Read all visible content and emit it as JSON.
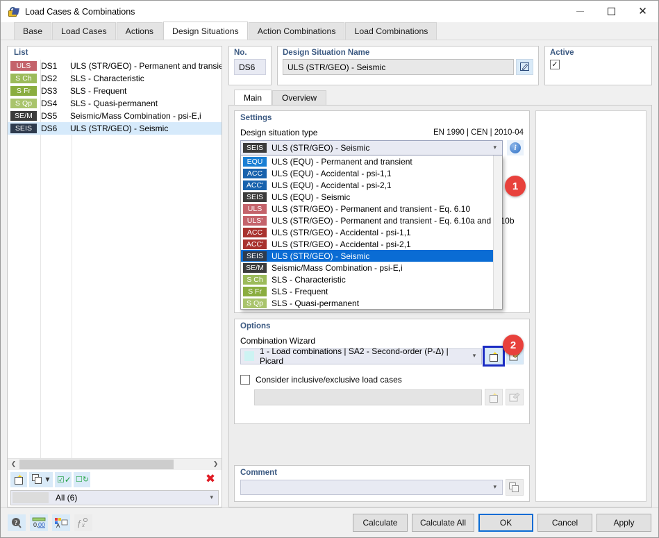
{
  "window": {
    "title": "Load Cases & Combinations",
    "icon": "padlock-icon",
    "minimize": "—",
    "maximize": "□",
    "close": "✕"
  },
  "tabs": [
    {
      "label": "Base",
      "active": false
    },
    {
      "label": "Load Cases",
      "active": false
    },
    {
      "label": "Actions",
      "active": false
    },
    {
      "label": "Design Situations",
      "active": true
    },
    {
      "label": "Action Combinations",
      "active": false
    },
    {
      "label": "Load Combinations",
      "active": false
    }
  ],
  "list_panel": {
    "title": "List",
    "rows": [
      {
        "badge": "ULS",
        "badge_color": "#c4636b",
        "no": "DS1",
        "name": "ULS (STR/GEO) - Permanent and transient - E",
        "selected": false
      },
      {
        "badge": "S Ch",
        "badge_color": "#9cbb5a",
        "no": "DS2",
        "name": "SLS - Characteristic",
        "selected": false
      },
      {
        "badge": "S Fr",
        "badge_color": "#8aad3f",
        "no": "DS3",
        "name": "SLS - Frequent",
        "selected": false
      },
      {
        "badge": "S Qp",
        "badge_color": "#a9c46c",
        "no": "DS4",
        "name": "SLS - Quasi-permanent",
        "selected": false
      },
      {
        "badge": "SE/M",
        "badge_color": "#3c3c3c",
        "no": "DS5",
        "name": "Seismic/Mass Combination - psi-E,i",
        "selected": false
      },
      {
        "badge": "SEIS",
        "badge_color": "#2e3b4e",
        "no": "DS6",
        "name": "ULS (STR/GEO) - Seismic",
        "selected": true
      }
    ],
    "toolbar": [
      {
        "name": "new-design-situation-button",
        "icon": "new-document-icon"
      },
      {
        "name": "copy-design-situation-button",
        "icon": "copy-with-dropdown-icon"
      },
      {
        "name": "select-all-button",
        "icon": "check-all-icon"
      },
      {
        "name": "invert-selection-button",
        "icon": "invert-selection-icon"
      },
      {
        "name": "delete-button",
        "icon": "red-x-icon"
      }
    ],
    "filter": {
      "label": "All (6)",
      "caret": "⌵"
    },
    "scroll": {
      "left_arrow": "❮",
      "right_arrow": "❯"
    }
  },
  "header_fields": {
    "no": {
      "label": "No.",
      "value": "DS6"
    },
    "name": {
      "label": "Design Situation Name",
      "value": "ULS (STR/GEO) - Seismic",
      "edit_icon": "rename-icon"
    },
    "active": {
      "label": "Active",
      "checked": true,
      "check_glyph": "✓"
    }
  },
  "inner_tabs": [
    {
      "label": "Main",
      "active": true
    },
    {
      "label": "Overview",
      "active": false
    }
  ],
  "settings": {
    "title": "Settings",
    "type_label": "Design situation type",
    "standard": "EN 1990 | CEN | 2010-04",
    "selected": {
      "badge": "SEIS",
      "badge_color": "#3c3c3c",
      "text": "ULS (STR/GEO) - Seismic"
    },
    "caret": "⌵",
    "info_icon": "info-icon",
    "info_glyph": "i",
    "options": [
      {
        "badge": "EQU",
        "badge_color": "#1a7fd4",
        "text": "ULS (EQU) - Permanent and transient",
        "selected": false
      },
      {
        "badge": "ACC",
        "badge_color": "#1862ad",
        "text": "ULS (EQU) - Accidental - psi-1,1",
        "selected": false
      },
      {
        "badge": "ACC'",
        "badge_color": "#1862ad",
        "text": "ULS (EQU) - Accidental - psi-2,1",
        "selected": false
      },
      {
        "badge": "SEIS",
        "badge_color": "#3c3c3c",
        "text": "ULS (EQU) - Seismic",
        "selected": false
      },
      {
        "badge": "ULS",
        "badge_color": "#c4636b",
        "text": "ULS (STR/GEO) - Permanent and transient - Eq. 6.10",
        "selected": false
      },
      {
        "badge": "ULS'",
        "badge_color": "#c4636b",
        "text": "ULS (STR/GEO) - Permanent and transient - Eq. 6.10a and 6.10b",
        "selected": false
      },
      {
        "badge": "ACC",
        "badge_color": "#a8322e",
        "text": "ULS (STR/GEO) - Accidental - psi-1,1",
        "selected": false
      },
      {
        "badge": "ACC'",
        "badge_color": "#a8322e",
        "text": "ULS (STR/GEO) - Accidental - psi-2,1",
        "selected": false
      },
      {
        "badge": "SEIS",
        "badge_color": "#2e3b4e",
        "text": "ULS (STR/GEO) - Seismic",
        "selected": true
      },
      {
        "badge": "SE/M",
        "badge_color": "#3c3c3c",
        "text": "Seismic/Mass Combination - psi-E,i",
        "selected": false
      },
      {
        "badge": "S Ch",
        "badge_color": "#9cbb5a",
        "text": "SLS - Characteristic",
        "selected": false
      },
      {
        "badge": "S Fr",
        "badge_color": "#8aad3f",
        "text": "SLS - Frequent",
        "selected": false
      },
      {
        "badge": "S Qp",
        "badge_color": "#a9c46c",
        "text": "SLS - Quasi-permanent",
        "selected": false
      }
    ]
  },
  "options_section": {
    "title": "Options",
    "wizard_label": "Combination Wizard",
    "wizard_value": "1 - Load combinations | SA2 - Second-order (P-Δ) | Picard",
    "wizard_caret": "⌵",
    "new_button_icon": "new-wizard-icon",
    "edit_button_icon": "edit-wizard-icon",
    "consider_label": "Consider inclusive/exclusive load cases",
    "consider_checked": false,
    "sub_new_icon": "new-wizard-icon",
    "sub_edit_icon": "edit-wizard-icon"
  },
  "comment_section": {
    "title": "Comment",
    "value": "",
    "caret": "⌵",
    "copy_icon": "copy-icon"
  },
  "callouts": [
    {
      "number": "1"
    },
    {
      "number": "2"
    }
  ],
  "footer": {
    "icons": [
      {
        "name": "help-icon",
        "glyph": "?"
      },
      {
        "name": "units-icon",
        "glyph": "0,00"
      },
      {
        "name": "display-properties-icon",
        "glyph": "A"
      },
      {
        "name": "formula-icon",
        "glyph": "f"
      }
    ],
    "buttons": [
      {
        "label": "Calculate",
        "primary": false
      },
      {
        "label": "Calculate All",
        "primary": false
      },
      {
        "label": "OK",
        "primary": true
      },
      {
        "label": "Cancel",
        "primary": false
      },
      {
        "label": "Apply",
        "primary": false
      }
    ]
  },
  "colors": {
    "accent_blue": "#0a6cd4",
    "callout_red": "#e8413c",
    "group_title": "#3c5a82",
    "highlight_box": "#1b2cc4"
  }
}
